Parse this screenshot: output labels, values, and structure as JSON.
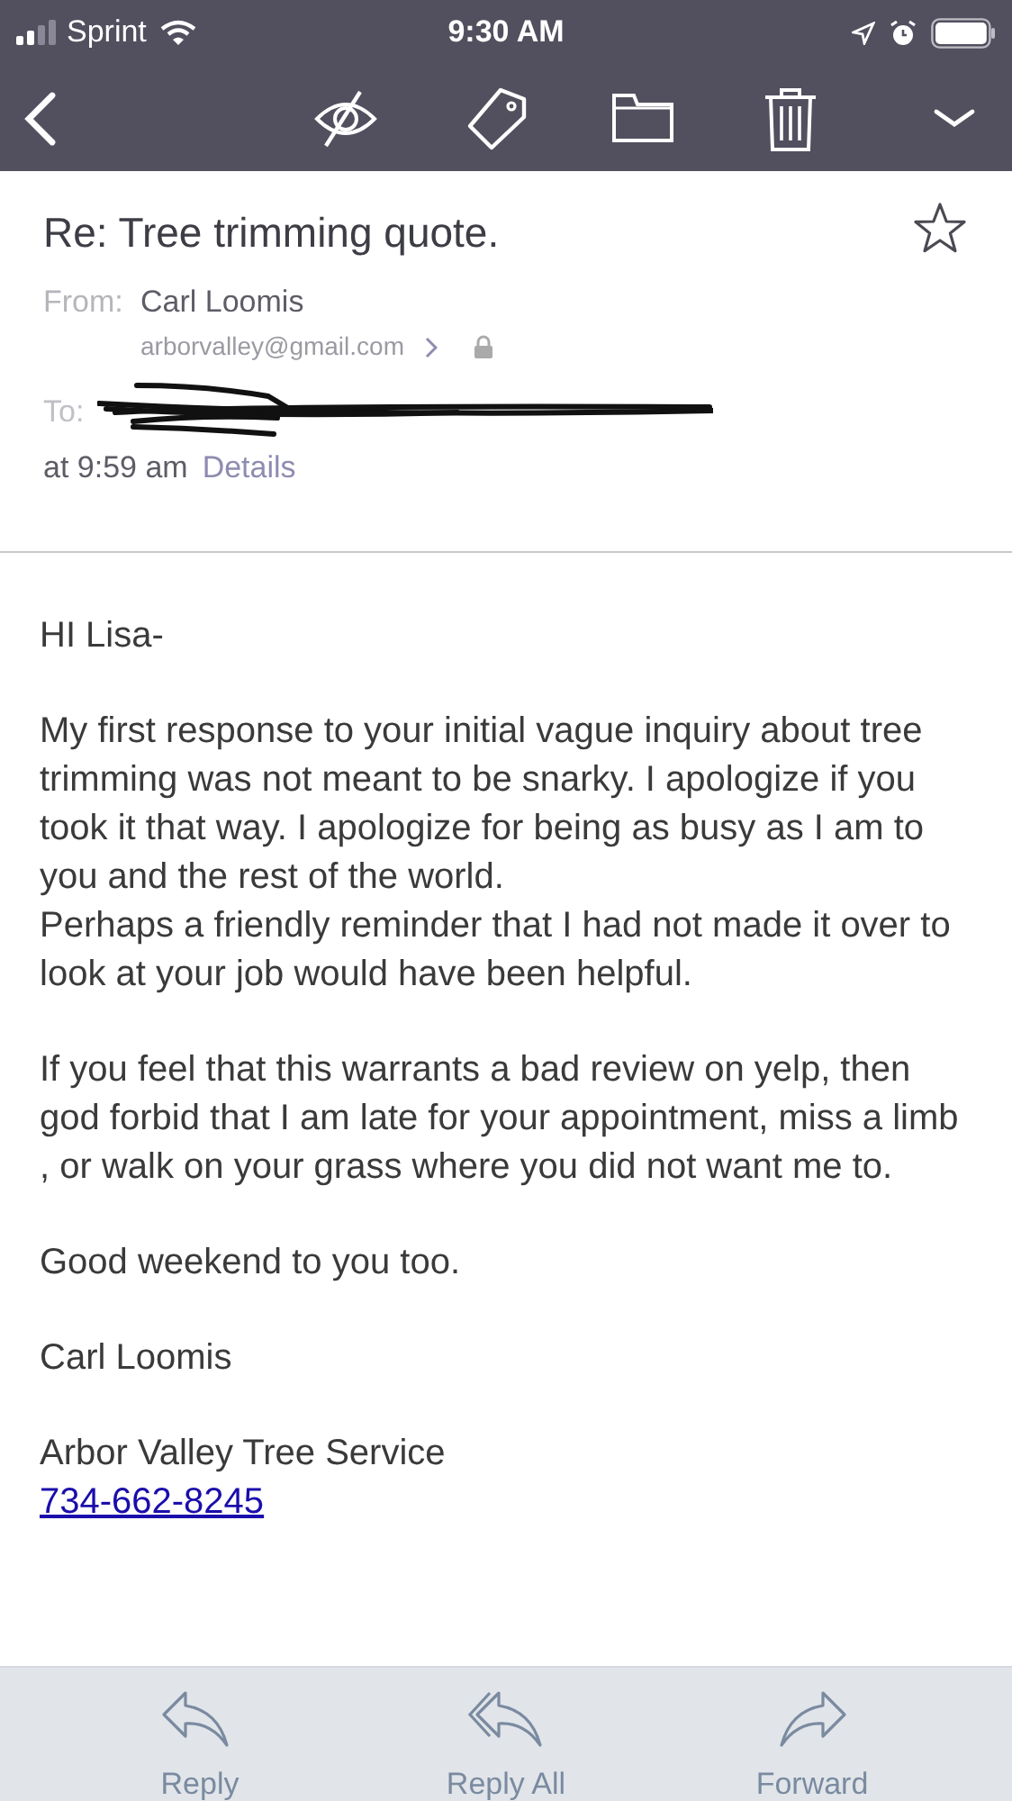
{
  "status_bar": {
    "carrier": "Sprint",
    "time": "9:30 AM"
  },
  "message": {
    "subject": "Re: Tree trimming quote.",
    "starred": false,
    "from_label": "From:",
    "from_name": "Carl Loomis",
    "from_address": "arborvalley@gmail.com",
    "to_label": "To:",
    "time": "at 9:59 am",
    "details_link": "Details"
  },
  "body": [
    [
      "HI Lisa-"
    ],
    [
      "My first response to your initial vague inquiry about tree trimming was not meant to be snarky. I apologize if you took it that way. I apologize for being as busy as I am to you and the rest of the world.",
      "Perhaps a friendly reminder that I had not made it over to look at your job would have been helpful."
    ],
    [
      "If you feel that this warrants a bad review on yelp, then god forbid that I am late for your appointment, miss a limb , or walk on your grass where you did not want me to."
    ],
    [
      "Good weekend to you too."
    ],
    [
      "Carl Loomis"
    ]
  ],
  "signature": {
    "company": "Arbor Valley Tree Service",
    "phone": "734-662-8245"
  },
  "actions": [
    {
      "kind": "reply",
      "label": "Reply"
    },
    {
      "kind": "reply_all",
      "label": "Reply All"
    },
    {
      "kind": "forward",
      "label": "Forward"
    }
  ]
}
